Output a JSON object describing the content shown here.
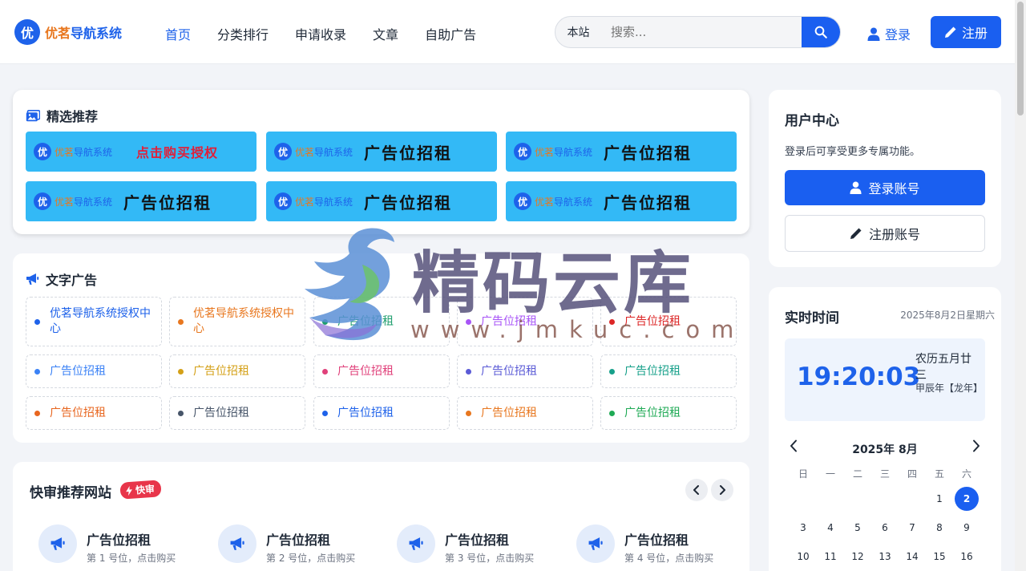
{
  "header": {
    "logo_badge": "优",
    "logo_text_1": "优茗",
    "logo_text_2": "导航系统",
    "nav": [
      "首页",
      "分类排行",
      "申请收录",
      "文章",
      "自助广告"
    ],
    "search_scope": "本站",
    "search_placeholder": "搜索...",
    "login_label": "登录",
    "register_label": "注册"
  },
  "featured": {
    "title": "精选推荐",
    "banners": [
      {
        "badge": "优",
        "brand1": "优茗",
        "brand2": "导航系统",
        "label": "点击购买授权"
      },
      {
        "badge": "优",
        "brand1": "优茗",
        "brand2": "导航系统",
        "label": "广告位招租"
      },
      {
        "badge": "优",
        "brand1": "优茗",
        "brand2": "导航系统",
        "label": "广告位招租"
      },
      {
        "badge": "优",
        "brand1": "优茗",
        "brand2": "导航系统",
        "label": "广告位招租"
      },
      {
        "badge": "优",
        "brand1": "优茗",
        "brand2": "导航系统",
        "label": "广告位招租"
      },
      {
        "badge": "优",
        "brand1": "优茗",
        "brand2": "导航系统",
        "label": "广告位招租"
      }
    ]
  },
  "text_ads": {
    "title": "文字广告",
    "items": [
      {
        "text": "优茗导航系统授权中心",
        "color": "#1e62ea"
      },
      {
        "text": "优茗导航系统授权中心",
        "color": "#e8771f"
      },
      {
        "text": "广告位招租",
        "color": "#1f9e6e"
      },
      {
        "text": "广告位招租",
        "color": "#a855f7"
      },
      {
        "text": "广告位招租",
        "color": "#dc2626"
      },
      {
        "text": "广告位招租",
        "color": "#3b82f6"
      },
      {
        "text": "广告位招租",
        "color": "#d4a017"
      },
      {
        "text": "广告位招租",
        "color": "#e0407a"
      },
      {
        "text": "广告位招租",
        "color": "#5b5bd6"
      },
      {
        "text": "广告位招租",
        "color": "#17a08a"
      },
      {
        "text": "广告位招租",
        "color": "#e8661f"
      },
      {
        "text": "广告位招租",
        "color": "#475569"
      },
      {
        "text": "广告位招租",
        "color": "#1e62ea"
      },
      {
        "text": "广告位招租",
        "color": "#e8771f"
      },
      {
        "text": "广告位招租",
        "color": "#1faa55"
      }
    ]
  },
  "quick_review": {
    "title": "快审推荐网站",
    "badge": "快审",
    "items": [
      {
        "name": "广告位招租",
        "sub": "第 1 号位，点击购买"
      },
      {
        "name": "广告位招租",
        "sub": "第 2 号位，点击购买"
      },
      {
        "name": "广告位招租",
        "sub": "第 3 号位，点击购买"
      },
      {
        "name": "广告位招租",
        "sub": "第 4 号位，点击购买"
      }
    ]
  },
  "user_center": {
    "title": "用户中心",
    "desc": "登录后可享受更多专属功能。",
    "login_label": "登录账号",
    "register_label": "注册账号"
  },
  "time_card": {
    "title": "实时时间",
    "date": "2025年8月2日星期六",
    "clock": "19:20:03",
    "lunar_day": "农历五月廿三",
    "lunar_year": "甲辰年【龙年】",
    "month_label": "2025年 8月",
    "weekdays": [
      "日",
      "一",
      "二",
      "三",
      "四",
      "五",
      "六"
    ],
    "week_rows": [
      [
        "",
        "",
        "",
        "",
        "",
        "1",
        "2"
      ],
      [
        "3",
        "4",
        "5",
        "6",
        "7",
        "8",
        "9"
      ],
      [
        "10",
        "11",
        "12",
        "13",
        "14",
        "15",
        "16"
      ]
    ],
    "today": "2"
  },
  "watermark": {
    "text": "精码云库",
    "url": "www.jmkuc.com"
  },
  "colors": {
    "primary": "#1a5ff0",
    "banner_bg": "#33b9f6",
    "brand_orange": "#e8771f"
  },
  "icons": {
    "search": "search-icon",
    "user": "user-icon",
    "pencil": "pencil-icon",
    "images": "images-icon",
    "megaphone": "megaphone-icon",
    "bolt": "bolt-icon"
  }
}
